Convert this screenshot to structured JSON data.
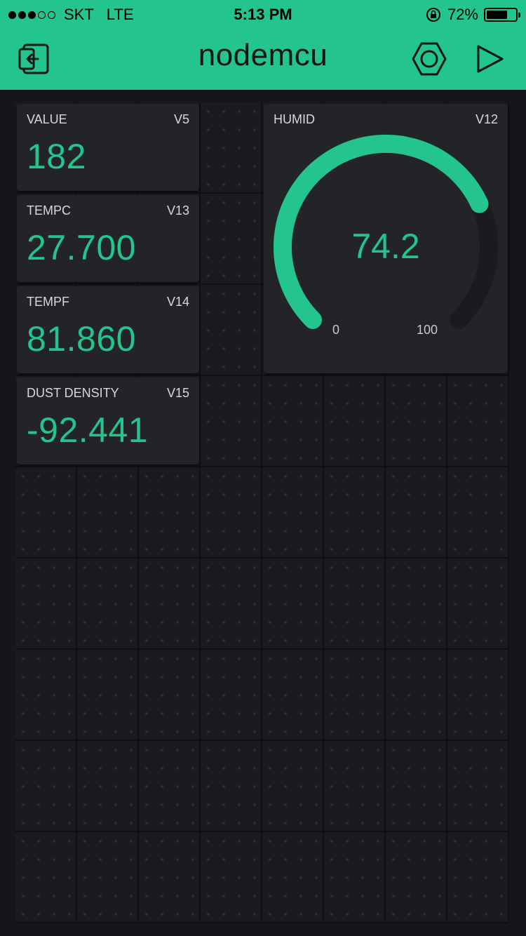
{
  "status_bar": {
    "carrier": "SKT",
    "network": "LTE",
    "time": "5:13 PM",
    "battery": "72%",
    "battery_level": 0.72,
    "signal_bars_filled": 3,
    "signal_bars_total": 5
  },
  "app_bar": {
    "title": "nodemcu",
    "icons": [
      "exit-icon",
      "settings-hexagon-icon",
      "play-icon"
    ]
  },
  "colors": {
    "accent": "#23c48e",
    "background": "#15161a",
    "widget_background": "#222428"
  },
  "widgets": {
    "value": {
      "label": "VALUE",
      "pin": "V5",
      "value": "182"
    },
    "tempc": {
      "label": "TEMPC",
      "pin": "V13",
      "value": "27.700"
    },
    "tempf": {
      "label": "TEMPF",
      "pin": "V14",
      "value": "81.860"
    },
    "dust": {
      "label": "DUST DENSITY",
      "pin": "V15",
      "value": "-92.441"
    },
    "humid": {
      "label": "HUMID",
      "pin": "V12",
      "value": "74.2",
      "min": "0",
      "max": "100",
      "level": 0.742
    }
  }
}
